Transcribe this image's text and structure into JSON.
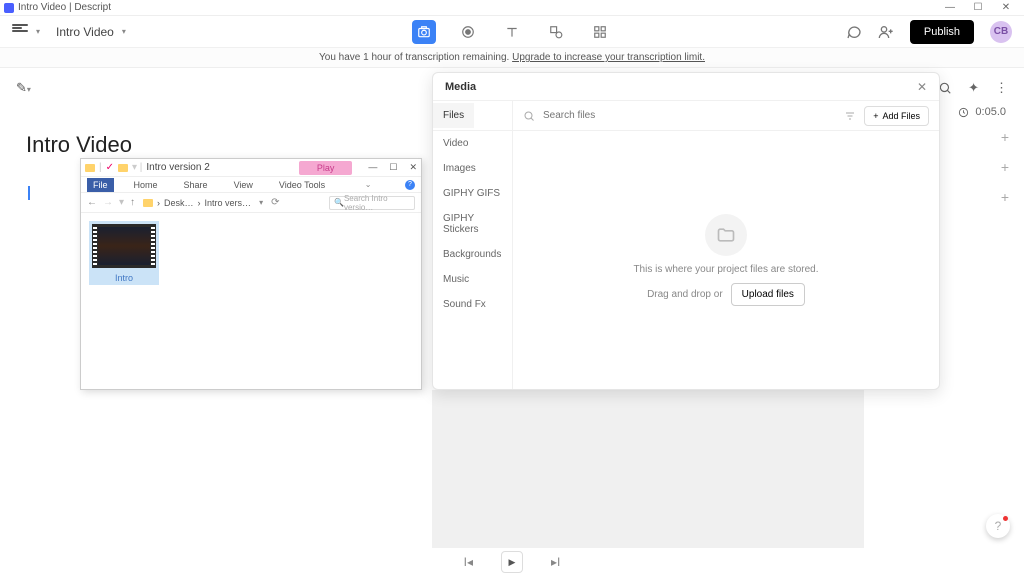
{
  "window": {
    "title": "Intro Video | Descript"
  },
  "toolbar": {
    "project_name": "Intro Video",
    "publish_label": "Publish",
    "avatar_initials": "CB"
  },
  "banner": {
    "text_before": "You have 1 hour of transcription remaining. ",
    "link": "Upgrade to increase your transcription limit."
  },
  "doc": {
    "title": "Intro Video"
  },
  "timecode": {
    "value": "0:05.0"
  },
  "file_explorer": {
    "title": "Intro version 2",
    "play": "Play",
    "tabs": [
      "File",
      "Home",
      "Share",
      "View",
      "Video Tools"
    ],
    "crumbs": [
      "Desk…",
      "Intro vers…"
    ],
    "search_placeholder": "Search Intro versio…",
    "item_label": "Intro"
  },
  "media": {
    "title": "Media",
    "search_placeholder": "Search files",
    "add_files": "Add Files",
    "tabs": [
      "Files",
      "Video",
      "Images",
      "GIPHY GIFS",
      "GIPHY Stickers",
      "Backgrounds",
      "Music",
      "Sound Fx"
    ],
    "empty_text": "This is where your project files are stored.",
    "drag_text": "Drag and drop or",
    "upload_label": "Upload files"
  }
}
